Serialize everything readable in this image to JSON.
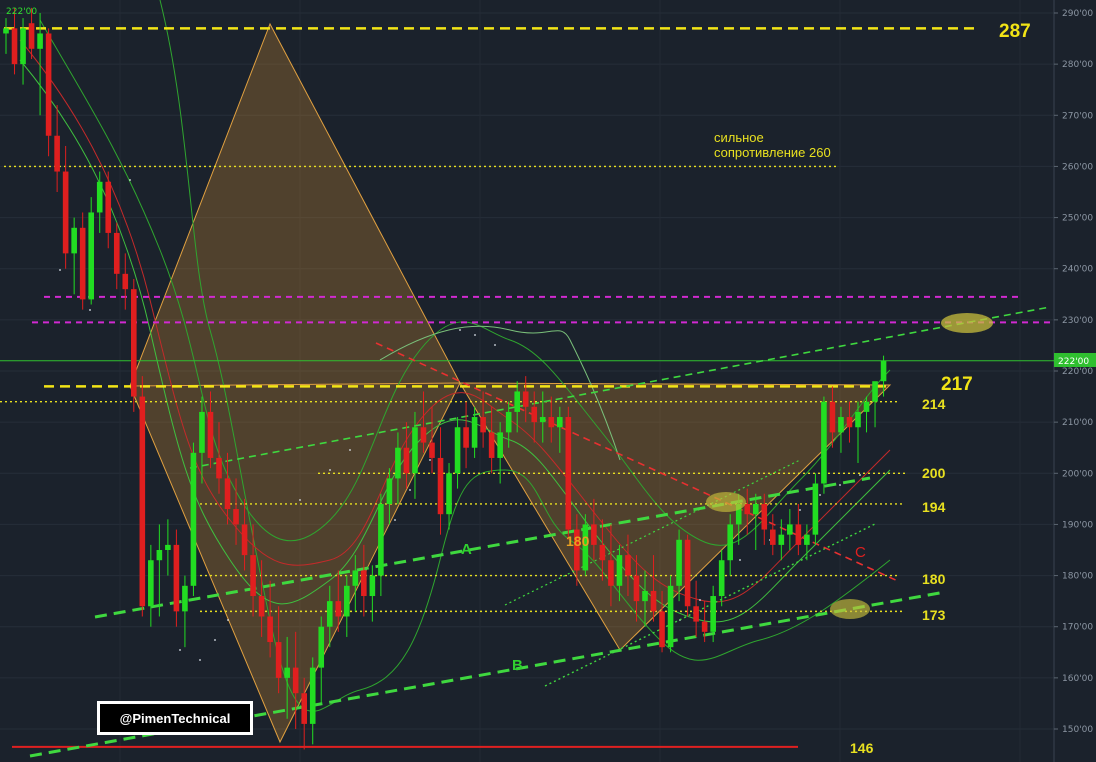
{
  "watermark": "@PimenTechnical",
  "top_left_price": "222'00",
  "current_price_tag": "222'00",
  "chart_data": {
    "type": "candlestick",
    "title": "",
    "ylim": [
      147,
      292
    ],
    "y_ticks": [
      "150'00",
      "160'00",
      "170'00",
      "180'00",
      "190'00",
      "200'00",
      "210'00",
      "220'00",
      "230'00",
      "240'00",
      "250'00",
      "260'00",
      "270'00",
      "280'00",
      "290'00"
    ],
    "levels": [
      {
        "name": "287",
        "value": 287,
        "color": "#f2e416",
        "style": "dash-thick"
      },
      {
        "name": "260",
        "value": 260,
        "color": "#e8e020",
        "style": "dotted"
      },
      {
        "name": "",
        "value": 234.5,
        "color": "#d12ad1",
        "style": "dash"
      },
      {
        "name": "",
        "value": 229.5,
        "color": "#d12ad1",
        "style": "dash"
      },
      {
        "name": "222",
        "value": 222,
        "color": "#2fbf2f",
        "style": "thin"
      },
      {
        "name": "217",
        "value": 217,
        "color": "#f2e416",
        "style": "dash-thick"
      },
      {
        "name": "214",
        "value": 214,
        "color": "#e8e020",
        "style": "dotted"
      },
      {
        "name": "200",
        "value": 200,
        "color": "#e8e020",
        "style": "dotted"
      },
      {
        "name": "194",
        "value": 194,
        "color": "#e8e020",
        "style": "dotted"
      },
      {
        "name": "180",
        "value": 180,
        "color": "#e8e020",
        "style": "dotted"
      },
      {
        "name": "173",
        "value": 173,
        "color": "#e8e020",
        "style": "dotted"
      },
      {
        "name": "146",
        "value": 146.5,
        "color": "#e02020",
        "style": "solid"
      }
    ],
    "annotations": [
      {
        "text": "сильное",
        "color": "#e8e020"
      },
      {
        "text": "сопротивление 260",
        "color": "#e8e020"
      },
      {
        "text": "287",
        "color": "#f2e416"
      },
      {
        "text": "217",
        "color": "#f2e416"
      },
      {
        "text": "214",
        "color": "#e8e020"
      },
      {
        "text": "200",
        "color": "#e8e020"
      },
      {
        "text": "194",
        "color": "#e8e020"
      },
      {
        "text": "180",
        "color": "#e8e020"
      },
      {
        "text": "173",
        "color": "#e8e020"
      },
      {
        "text": "146",
        "color": "#e8e020"
      },
      {
        "text": "180",
        "color": "#e8a020"
      },
      {
        "text": "A",
        "color": "#2fd02f"
      },
      {
        "text": "B",
        "color": "#2fd02f"
      },
      {
        "text": "C",
        "color": "#e02020"
      }
    ],
    "candles": [
      [
        286,
        289,
        282,
        287
      ],
      [
        287,
        291,
        278,
        280
      ],
      [
        280,
        289,
        276,
        287
      ],
      [
        288,
        291,
        281,
        283
      ],
      [
        283,
        290,
        270,
        286
      ],
      [
        286,
        287,
        262,
        266
      ],
      [
        266,
        272,
        255,
        259
      ],
      [
        259,
        264,
        240,
        243
      ],
      [
        243,
        250,
        235,
        248
      ],
      [
        248,
        251,
        232,
        234
      ],
      [
        234,
        254,
        233,
        251
      ],
      [
        251,
        259,
        247,
        257
      ],
      [
        257,
        259,
        244,
        247
      ],
      [
        247,
        249,
        236,
        239
      ],
      [
        239,
        243,
        232,
        236
      ],
      [
        236,
        238,
        212,
        215
      ],
      [
        215,
        219,
        172,
        174
      ],
      [
        174,
        186,
        170,
        183
      ],
      [
        183,
        190,
        172,
        185
      ],
      [
        185,
        191,
        180,
        186
      ],
      [
        186,
        189,
        170,
        173
      ],
      [
        173,
        180,
        166,
        178
      ],
      [
        178,
        206,
        176,
        204
      ],
      [
        204,
        215,
        198,
        212
      ],
      [
        212,
        216,
        201,
        203
      ],
      [
        203,
        210,
        196,
        199
      ],
      [
        199,
        204,
        190,
        193
      ],
      [
        193,
        199,
        186,
        190
      ],
      [
        190,
        195,
        181,
        184
      ],
      [
        184,
        190,
        172,
        176
      ],
      [
        176,
        183,
        168,
        172
      ],
      [
        172,
        179,
        164,
        167
      ],
      [
        167,
        174,
        157,
        160
      ],
      [
        160,
        168,
        152,
        162
      ],
      [
        162,
        169,
        150,
        157
      ],
      [
        157,
        160,
        146,
        151
      ],
      [
        151,
        164,
        147,
        162
      ],
      [
        162,
        172,
        155,
        170
      ],
      [
        170,
        178,
        166,
        175
      ],
      [
        175,
        181,
        169,
        172
      ],
      [
        172,
        180,
        168,
        178
      ],
      [
        178,
        184,
        173,
        181
      ],
      [
        181,
        186,
        172,
        176
      ],
      [
        176,
        182,
        171,
        180
      ],
      [
        180,
        196,
        176,
        194
      ],
      [
        194,
        201,
        190,
        199
      ],
      [
        199,
        208,
        194,
        205
      ],
      [
        205,
        210,
        197,
        200
      ],
      [
        200,
        212,
        195,
        209
      ],
      [
        209,
        216,
        204,
        206
      ],
      [
        206,
        213,
        200,
        203
      ],
      [
        203,
        209,
        188,
        192
      ],
      [
        192,
        202,
        189,
        200
      ],
      [
        200,
        211,
        197,
        209
      ],
      [
        209,
        214,
        201,
        205
      ],
      [
        205,
        213,
        203,
        211
      ],
      [
        211,
        216,
        205,
        208
      ],
      [
        208,
        213,
        200,
        203
      ],
      [
        203,
        210,
        198,
        208
      ],
      [
        208,
        214,
        205,
        212
      ],
      [
        212,
        218,
        208,
        216
      ],
      [
        216,
        219,
        210,
        213
      ],
      [
        213,
        216,
        206,
        210
      ],
      [
        210,
        216,
        206,
        211
      ],
      [
        211,
        215,
        206,
        209
      ],
      [
        209,
        213,
        204,
        211
      ],
      [
        211,
        213,
        187,
        189
      ],
      [
        189,
        192,
        178,
        181
      ],
      [
        181,
        192,
        180,
        190
      ],
      [
        190,
        195,
        183,
        186
      ],
      [
        186,
        191,
        179,
        183
      ],
      [
        183,
        190,
        174,
        178
      ],
      [
        178,
        186,
        175,
        184
      ],
      [
        184,
        188,
        176,
        180
      ],
      [
        180,
        184,
        171,
        175
      ],
      [
        175,
        181,
        170,
        177
      ],
      [
        177,
        184,
        171,
        173
      ],
      [
        173,
        177,
        165,
        166
      ],
      [
        166,
        180,
        165,
        178
      ],
      [
        178,
        189,
        175,
        187
      ],
      [
        187,
        188,
        172,
        174
      ],
      [
        174,
        179,
        168,
        171
      ],
      [
        171,
        175,
        167,
        169
      ],
      [
        169,
        178,
        167,
        176
      ],
      [
        176,
        185,
        174,
        183
      ],
      [
        183,
        192,
        180,
        190
      ],
      [
        190,
        196,
        186,
        194
      ],
      [
        194,
        197,
        188,
        192
      ],
      [
        192,
        196,
        185,
        194
      ],
      [
        194,
        196,
        186,
        189
      ],
      [
        189,
        192,
        184,
        186
      ],
      [
        186,
        191,
        183,
        188
      ],
      [
        188,
        193,
        185,
        190
      ],
      [
        190,
        194,
        184,
        186
      ],
      [
        186,
        190,
        183,
        188
      ],
      [
        188,
        200,
        186,
        198
      ],
      [
        198,
        215,
        196,
        214
      ],
      [
        214,
        217,
        205,
        208
      ],
      [
        208,
        213,
        204,
        211
      ],
      [
        211,
        214,
        206,
        209
      ],
      [
        209,
        214,
        202,
        212
      ],
      [
        212,
        215,
        208,
        214
      ],
      [
        214,
        217,
        209,
        218
      ],
      [
        218,
        223,
        215,
        222
      ]
    ]
  }
}
